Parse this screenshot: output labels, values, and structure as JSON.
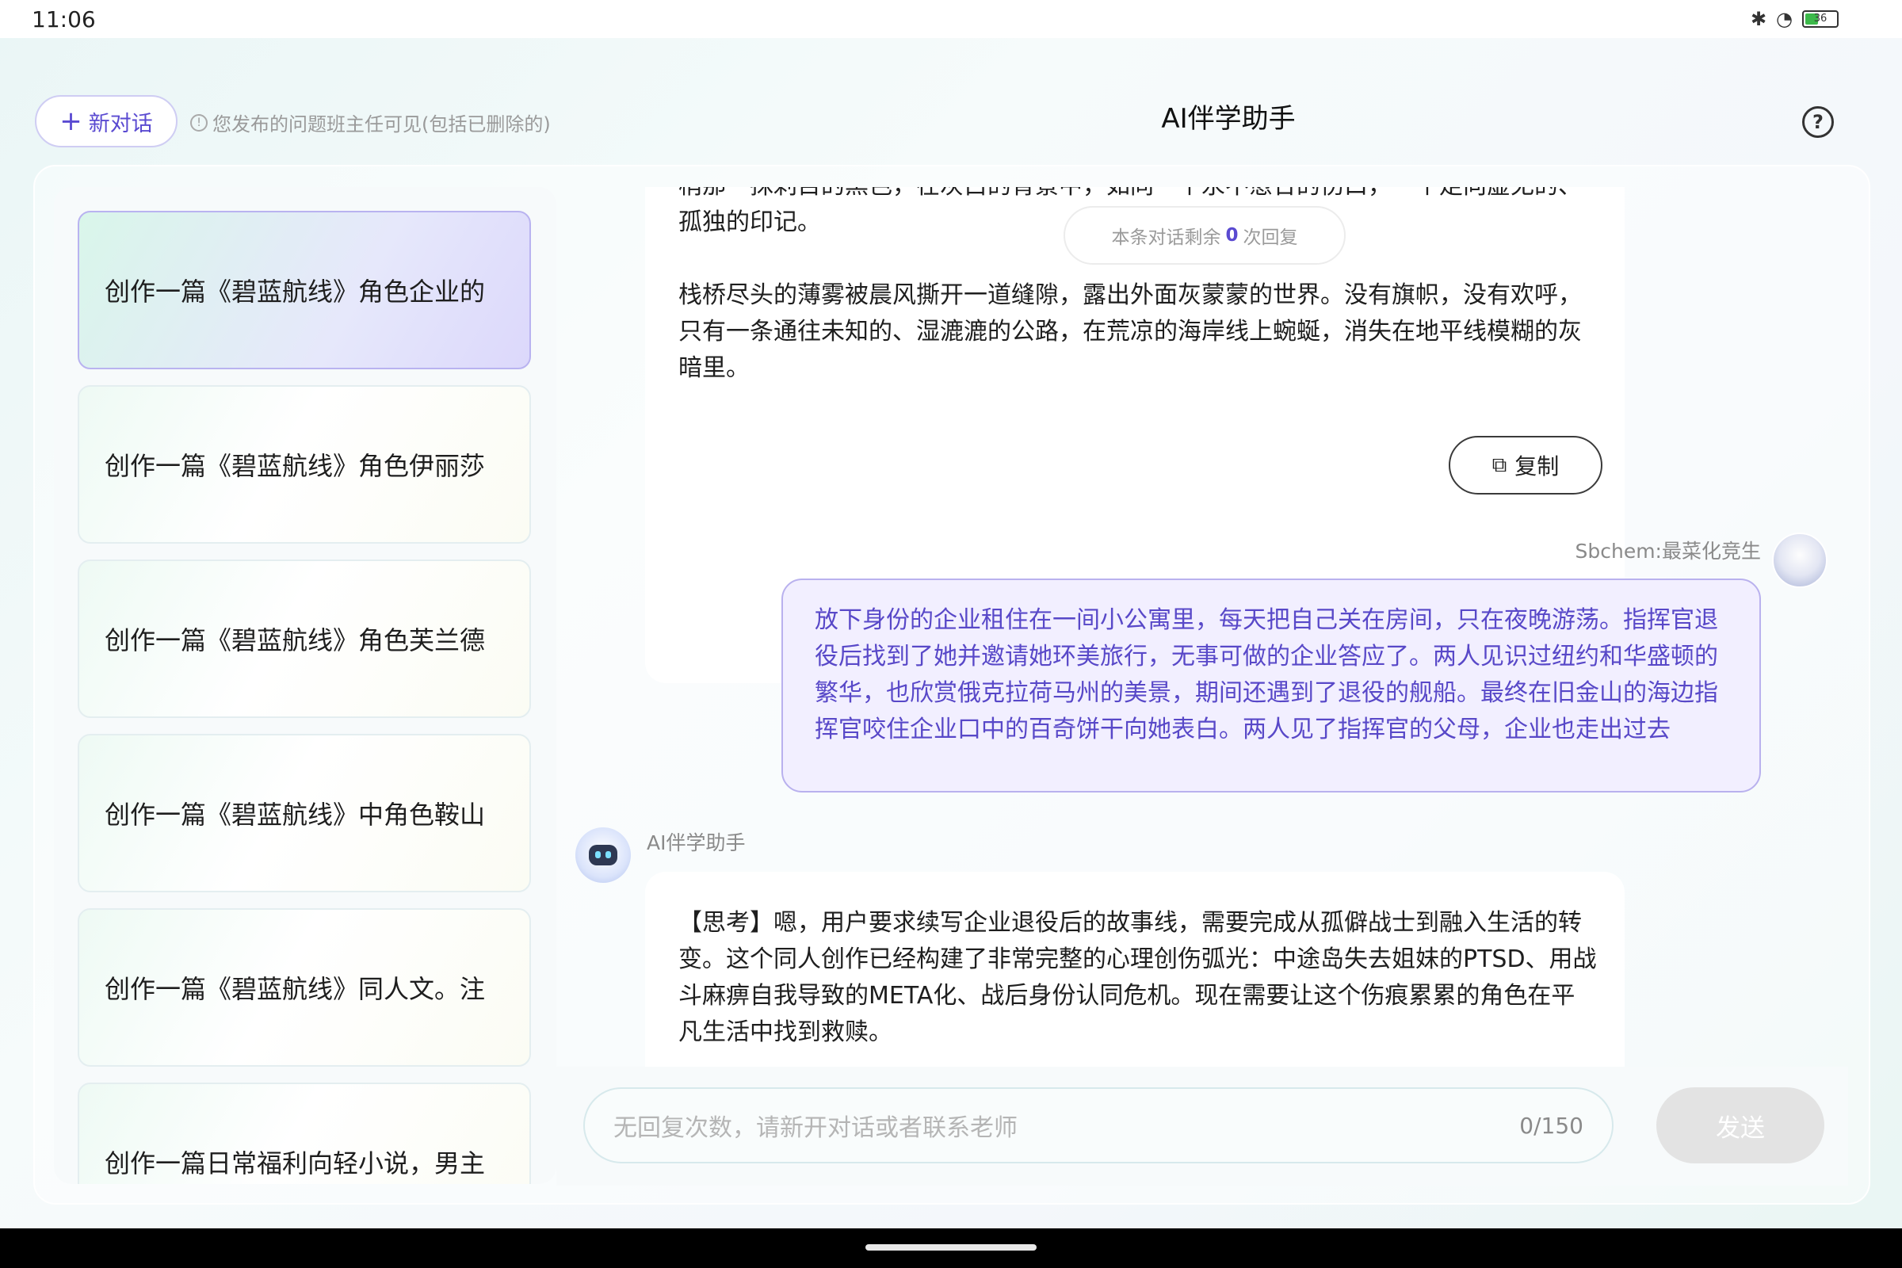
{
  "status_bar": {
    "time": "11:06",
    "battery": "36"
  },
  "header": {
    "new_chat_label": "新对话",
    "notice": "您发布的问题班主任可见(包括已删除的)",
    "title": "AI伴学助手",
    "help_symbol": "?"
  },
  "sidebar": {
    "items": [
      {
        "label": "创作一篇《碧蓝航线》角色企业的"
      },
      {
        "label": "创作一篇《碧蓝航线》角色伊丽莎"
      },
      {
        "label": "创作一篇《碧蓝航线》角色芙兰德"
      },
      {
        "label": "创作一篇《碧蓝航线》中角色鞍山"
      },
      {
        "label": "创作一篇《碧蓝航线》同人文。注"
      },
      {
        "label": "创作一篇日常福利向轻小说，男主"
      }
    ]
  },
  "chat": {
    "ai_msg1": {
      "cut_line": "梢那一抹刺目的黑色，在灰白的背景中，如同一个永不愈合的伤口，一个走向虚无的、",
      "partial_line": "孤独的印记。",
      "para2": "栈桥尽头的薄雾被晨风撕开一道缝隙，露出外面灰蒙蒙的世界。没有旗帜，没有欢呼，只有一条通往未知的、湿漉漉的公路，在荒凉的海岸线上蜿蜒，消失在地平线模糊的灰暗里。",
      "copy_label": "复制"
    },
    "remaining": {
      "prefix": "本条对话剩余",
      "count": "0",
      "suffix": "次回复"
    },
    "user": {
      "name": "Sbchem:最菜化竞生",
      "message": "放下身份的企业租住在一间小公寓里，每天把自己关在房间，只在夜晚游荡。指挥官退役后找到了她并邀请她环美旅行，无事可做的企业答应了。两人见识过纽约和华盛顿的繁华，也欣赏俄克拉荷马州的美景，期间还遇到了退役的舰船。最终在旧金山的海边指挥官咬住企业口中的百奇饼干向她表白。两人见了指挥官的父母，企业也走出过去"
    },
    "ai_msg2": {
      "name": "AI伴学助手",
      "text": "【思考】嗯，用户要求续写企业退役后的故事线，需要完成从孤僻战士到融入生活的转变。这个同人创作已经构建了非常完整的心理创伤弧光：中途岛失去姐妹的PTSD、用战斗麻痹自我导致的META化、战后身份认同危机。现在需要让这个伤痕累累的角色在平凡生活中找到救赎。"
    }
  },
  "input": {
    "placeholder": "无回复次数，请新开对话或者联系老师",
    "counter": "0/150",
    "send_label": "发送"
  },
  "colors": {
    "accent": "#5a4ad1",
    "user_bubble_bg": "#f2efff",
    "user_bubble_border": "#b9b1ee"
  },
  "icons": {
    "wifi": "wifi-icon",
    "bluetooth": "bluetooth-icon",
    "copy": "copy-icon",
    "help": "help-icon"
  }
}
